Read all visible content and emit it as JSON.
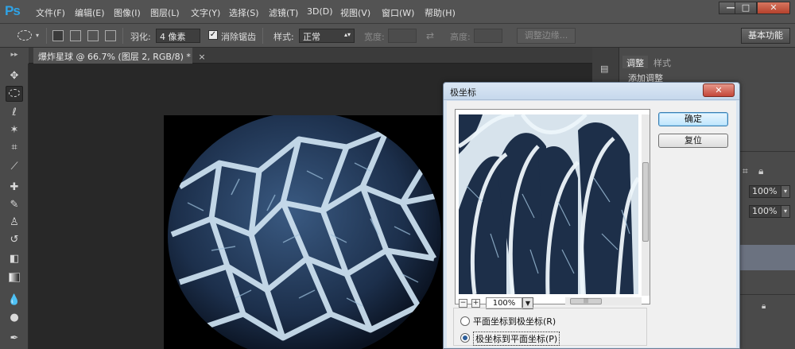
{
  "app": {
    "logo": "Ps"
  },
  "menu": [
    "文件(F)",
    "编辑(E)",
    "图像(I)",
    "图层(L)",
    "文字(Y)",
    "选择(S)",
    "滤镜(T)",
    "3D(D)",
    "视图(V)",
    "窗口(W)",
    "帮助(H)"
  ],
  "window_controls": {
    "minimize": "—",
    "maximize": "□",
    "close": "✕"
  },
  "options": {
    "feather_label": "羽化:",
    "feather_value": "4 像素",
    "antialias_label": "消除锯齿",
    "antialias_checked": true,
    "style_label": "样式:",
    "style_value": "正常",
    "width_label": "宽度:",
    "height_label": "高度:",
    "refine_label": "调整边缘...",
    "workspace_label": "基本功能"
  },
  "document": {
    "tab_title": "爆炸星球 @ 66.7% (图层 2, RGB/8) *",
    "close_glyph": "×"
  },
  "panels": {
    "tabs": [
      "调整",
      "样式"
    ],
    "add_adjustment": "添加调整",
    "opacity_value": "100%",
    "fill_value": "100%"
  },
  "dialog": {
    "title": "极坐标",
    "close_glyph": "✕",
    "ok_label": "确定",
    "reset_label": "复位",
    "zoom_value": "100%",
    "zoom_minus": "−",
    "zoom_plus": "+",
    "radio_options": [
      {
        "label": "平面坐标到极坐标(R)",
        "selected": false
      },
      {
        "label": "极坐标到平面坐标(P)",
        "selected": true
      }
    ]
  },
  "colors": {
    "ps_blue": "#2fa3e6",
    "panel_bg": "#4a4a4a",
    "dialog_bg": "#f0f0f0",
    "planet_blue": "#1e3352",
    "crack_white": "#cfe3f2"
  }
}
